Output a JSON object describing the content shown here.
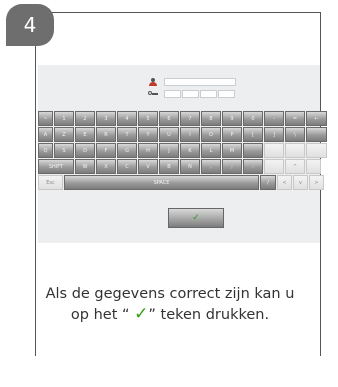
{
  "step": {
    "number": "4"
  },
  "form": {
    "user_icon": "user-icon",
    "pin_icon": "key-icon",
    "username_value": "",
    "pin_values": [
      "",
      "",
      "",
      ""
    ]
  },
  "keyboard": {
    "rows": [
      {
        "keys": [
          {
            "label": "~",
            "w": 15
          },
          {
            "label": "1",
            "w": 20
          },
          {
            "label": "2",
            "w": 20
          },
          {
            "label": "3",
            "w": 20
          },
          {
            "label": "4",
            "w": 20
          },
          {
            "label": "5",
            "w": 20
          },
          {
            "label": "6",
            "w": 20
          },
          {
            "label": "7",
            "w": 20
          },
          {
            "label": "8",
            "w": 20
          },
          {
            "label": "9",
            "w": 20
          },
          {
            "label": "0",
            "w": 20
          },
          {
            "label": "-",
            "w": 20
          },
          {
            "label": "=",
            "w": 20
          },
          {
            "label": "←",
            "w": 21
          }
        ]
      },
      {
        "keys": [
          {
            "label": "A",
            "w": 15
          },
          {
            "label": "Z",
            "w": 20
          },
          {
            "label": "E",
            "w": 20
          },
          {
            "label": "R",
            "w": 20
          },
          {
            "label": "T",
            "w": 20
          },
          {
            "label": "Y",
            "w": 20
          },
          {
            "label": "U",
            "w": 20
          },
          {
            "label": "I",
            "w": 20
          },
          {
            "label": "O",
            "w": 20
          },
          {
            "label": "P",
            "w": 20
          },
          {
            "label": "[",
            "w": 20
          },
          {
            "label": "]",
            "w": 20
          },
          {
            "label": "\\",
            "w": 20
          },
          {
            "label": "",
            "w": 21
          }
        ]
      },
      {
        "keys": [
          {
            "label": "Q",
            "w": 15
          },
          {
            "label": "S",
            "w": 20
          },
          {
            "label": "D",
            "w": 20
          },
          {
            "label": "F",
            "w": 20
          },
          {
            "label": "G",
            "w": 20
          },
          {
            "label": "H",
            "w": 20
          },
          {
            "label": "J",
            "w": 20
          },
          {
            "label": "K",
            "w": 20
          },
          {
            "label": "L",
            "w": 20
          },
          {
            "label": "M",
            "w": 20
          },
          {
            "label": "",
            "w": 20
          },
          {
            "label": "",
            "w": 20,
            "light": true
          },
          {
            "label": "",
            "w": 20,
            "light": true
          },
          {
            "label": "",
            "w": 21,
            "light": true
          }
        ]
      },
      {
        "keys": [
          {
            "label": "SHIFT",
            "w": 36
          },
          {
            "label": "W",
            "w": 20
          },
          {
            "label": "X",
            "w": 20
          },
          {
            "label": "C",
            "w": 20
          },
          {
            "label": "V",
            "w": 20
          },
          {
            "label": "B",
            "w": 20
          },
          {
            "label": "N",
            "w": 20
          },
          {
            "label": ",",
            "w": 20
          },
          {
            "label": ";",
            "w": 20
          },
          {
            "label": ":",
            "w": 20
          },
          {
            "label": "",
            "w": 20,
            "light": true
          },
          {
            "label": "^",
            "w": 20,
            "light": true
          },
          {
            "label": "",
            "w": 15,
            "light": true
          }
        ]
      },
      {
        "keys": [
          {
            "label": "Esc",
            "w": 25,
            "light": true
          },
          {
            "label": "SPACE",
            "w": 195
          },
          {
            "label": "/",
            "w": 16
          },
          {
            "label": "<",
            "w": 15,
            "light": true
          },
          {
            "label": "v",
            "w": 15,
            "light": true
          },
          {
            "label": ">",
            "w": 15,
            "light": true
          }
        ]
      }
    ],
    "ok_label": "✓"
  },
  "caption": {
    "before": "Als de gegevens correct zijn kan u op het “ ",
    "check": "✓",
    "after": "” teken drukken."
  }
}
